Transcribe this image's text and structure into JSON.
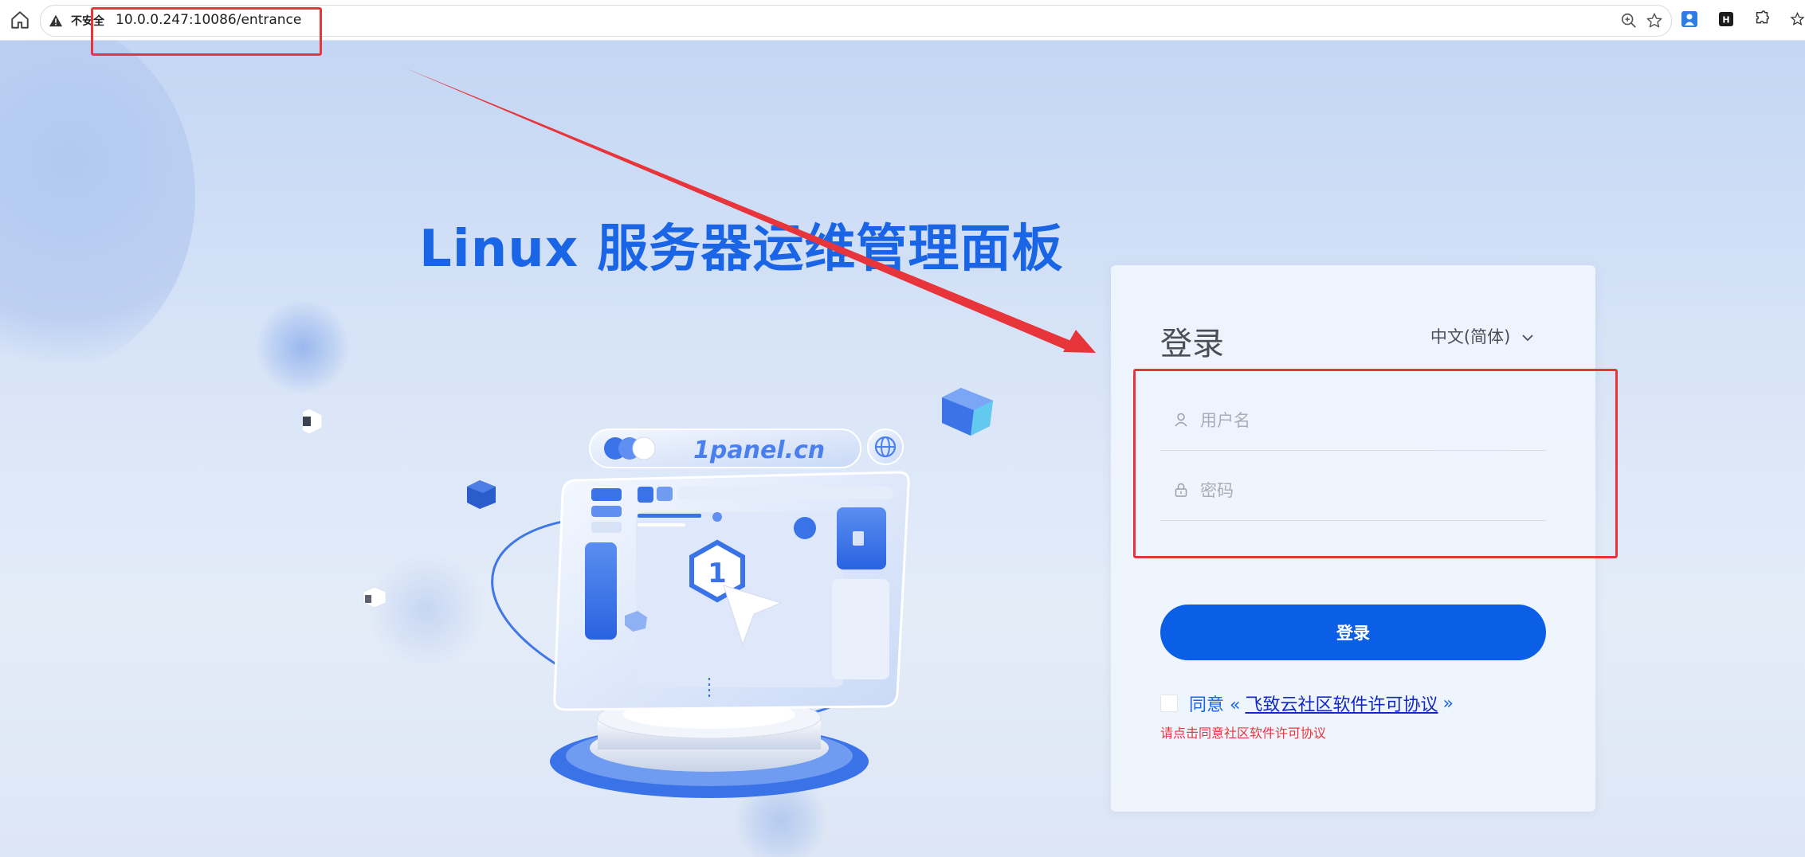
{
  "browser": {
    "security_label": "不安全",
    "url": "10.0.0.247:10086/entrance"
  },
  "hero": {
    "title": "Linux 服务器运维管理面板",
    "illustration_text": "1panel.cn"
  },
  "login": {
    "title": "登录",
    "language": "中文(简体)",
    "username_placeholder": "用户名",
    "password_placeholder": "密码",
    "submit_label": "登录",
    "agree_prefix": "同意 «",
    "agree_link": "飞致云社区软件许可协议",
    "agree_suffix": "»",
    "agree_hint": "请点击同意社区软件许可协议"
  },
  "colors": {
    "primary": "#0b5fe6",
    "title_blue": "#1a64e6",
    "annotation_red": "#e8353b"
  },
  "icons": [
    "home-icon",
    "warning-icon",
    "zoom-icon",
    "star-icon",
    "user-icon",
    "lock-icon",
    "chevron-down-icon",
    "globe-icon"
  ]
}
